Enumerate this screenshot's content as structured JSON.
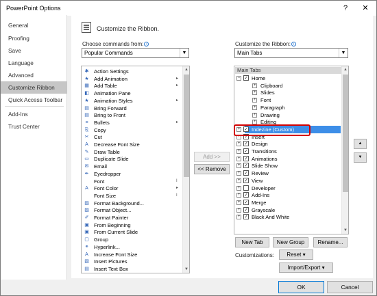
{
  "window": {
    "title": "PowerPoint Options",
    "help": "?",
    "close": "✕"
  },
  "nav": {
    "items": [
      "General",
      "Proofing",
      "Save",
      "Language",
      "Advanced",
      "Customize Ribbon",
      "Quick Access Toolbar",
      "Add-Ins",
      "Trust Center"
    ],
    "selected": "Customize Ribbon"
  },
  "header": {
    "title": "Customize the Ribbon."
  },
  "left": {
    "label": "Choose commands from:",
    "info": "i",
    "combo_value": "Popular Commands",
    "commands": [
      {
        "label": "Action Settings",
        "icon": "✱",
        "sub": ""
      },
      {
        "label": "Add Animation",
        "icon": "★",
        "sub": "▸"
      },
      {
        "label": "Add Table",
        "icon": "▦",
        "sub": "▸"
      },
      {
        "label": "Animation Pane",
        "icon": "◧",
        "sub": ""
      },
      {
        "label": "Animation Styles",
        "icon": "★",
        "sub": "▸"
      },
      {
        "label": "Bring Forward",
        "icon": "▤",
        "sub": ""
      },
      {
        "label": "Bring to Front",
        "icon": "▤",
        "sub": ""
      },
      {
        "label": "Bullets",
        "icon": "≡",
        "sub": "▸"
      },
      {
        "label": "Copy",
        "icon": "⎘",
        "sub": ""
      },
      {
        "label": "Cut",
        "icon": "✂",
        "sub": ""
      },
      {
        "label": "Decrease Font Size",
        "icon": "A",
        "sub": ""
      },
      {
        "label": "Draw Table",
        "icon": "✎",
        "sub": ""
      },
      {
        "label": "Duplicate Slide",
        "icon": "▭",
        "sub": ""
      },
      {
        "label": "Email",
        "icon": "✉",
        "sub": ""
      },
      {
        "label": "Eyedropper",
        "icon": "✒",
        "sub": ""
      },
      {
        "label": "Font",
        "icon": "",
        "sub": "I"
      },
      {
        "label": "Font Color",
        "icon": "A",
        "sub": "▸"
      },
      {
        "label": "Font Size",
        "icon": "",
        "sub": "I"
      },
      {
        "label": "Format Background...",
        "icon": "▨",
        "sub": ""
      },
      {
        "label": "Format Object...",
        "icon": "▨",
        "sub": ""
      },
      {
        "label": "Format Painter",
        "icon": "✐",
        "sub": ""
      },
      {
        "label": "From Beginning",
        "icon": "▣",
        "sub": ""
      },
      {
        "label": "From Current Slide",
        "icon": "▣",
        "sub": ""
      },
      {
        "label": "Group",
        "icon": "▢",
        "sub": ""
      },
      {
        "label": "Hyperlink...",
        "icon": "⚭",
        "sub": ""
      },
      {
        "label": "Increase Font Size",
        "icon": "A",
        "sub": ""
      },
      {
        "label": "Insert Pictures",
        "icon": "▧",
        "sub": ""
      },
      {
        "label": "Insert Text Box",
        "icon": "▤",
        "sub": ""
      }
    ]
  },
  "middle": {
    "add_label": "Add >>",
    "remove_label": "<< Remove"
  },
  "right": {
    "label": "Customize the Ribbon:",
    "info": "i",
    "combo_value": "Main Tabs",
    "group_header": "Main Tabs",
    "tree": [
      {
        "label": "Home",
        "level": 0,
        "expander": "⊟",
        "checkbox": true
      },
      {
        "label": "Clipboard",
        "level": 1,
        "expander": "⊞",
        "checkbox": false
      },
      {
        "label": "Slides",
        "level": 1,
        "expander": "⊞",
        "checkbox": false
      },
      {
        "label": "Font",
        "level": 1,
        "expander": "⊞",
        "checkbox": false
      },
      {
        "label": "Paragraph",
        "level": 1,
        "expander": "⊞",
        "checkbox": false
      },
      {
        "label": "Drawing",
        "level": 1,
        "expander": "⊞",
        "checkbox": false
      },
      {
        "label": "Editing",
        "level": 1,
        "expander": "⊞",
        "checkbox": false
      },
      {
        "label": "Indezine (Custom)",
        "level": 0,
        "expander": "⊞",
        "checkbox": true,
        "selected": true
      },
      {
        "label": "Insert",
        "level": 0,
        "expander": "⊞",
        "checkbox": true
      },
      {
        "label": "Design",
        "level": 0,
        "expander": "⊞",
        "checkbox": true
      },
      {
        "label": "Transitions",
        "level": 0,
        "expander": "⊞",
        "checkbox": true
      },
      {
        "label": "Animations",
        "level": 0,
        "expander": "⊞",
        "checkbox": true
      },
      {
        "label": "Slide Show",
        "level": 0,
        "expander": "⊞",
        "checkbox": true
      },
      {
        "label": "Review",
        "level": 0,
        "expander": "⊞",
        "checkbox": true
      },
      {
        "label": "View",
        "level": 0,
        "expander": "⊞",
        "checkbox": true
      },
      {
        "label": "Developer",
        "level": 0,
        "expander": "⊞",
        "checkbox": false
      },
      {
        "label": "Add-Ins",
        "level": 0,
        "expander": "⊞",
        "checkbox": true
      },
      {
        "label": "Merge",
        "level": 0,
        "expander": "⊞",
        "checkbox": true
      },
      {
        "label": "Grayscale",
        "level": 0,
        "expander": "⊞",
        "checkbox": true
      },
      {
        "label": "Black And White",
        "level": 0,
        "expander": "⊞",
        "checkbox": true
      }
    ],
    "new_tab": "New Tab",
    "new_group": "New Group",
    "rename": "Rename...",
    "customizations_label": "Customizations:",
    "reset": "Reset",
    "import_export": "Import/Export",
    "move_up": "▲",
    "move_down": "▼"
  },
  "footer": {
    "ok": "OK",
    "cancel": "Cancel"
  },
  "colors": {
    "selection": "#3d8ee8",
    "highlight_outline": "#d40000",
    "nav_selected": "#c6c6c6"
  }
}
